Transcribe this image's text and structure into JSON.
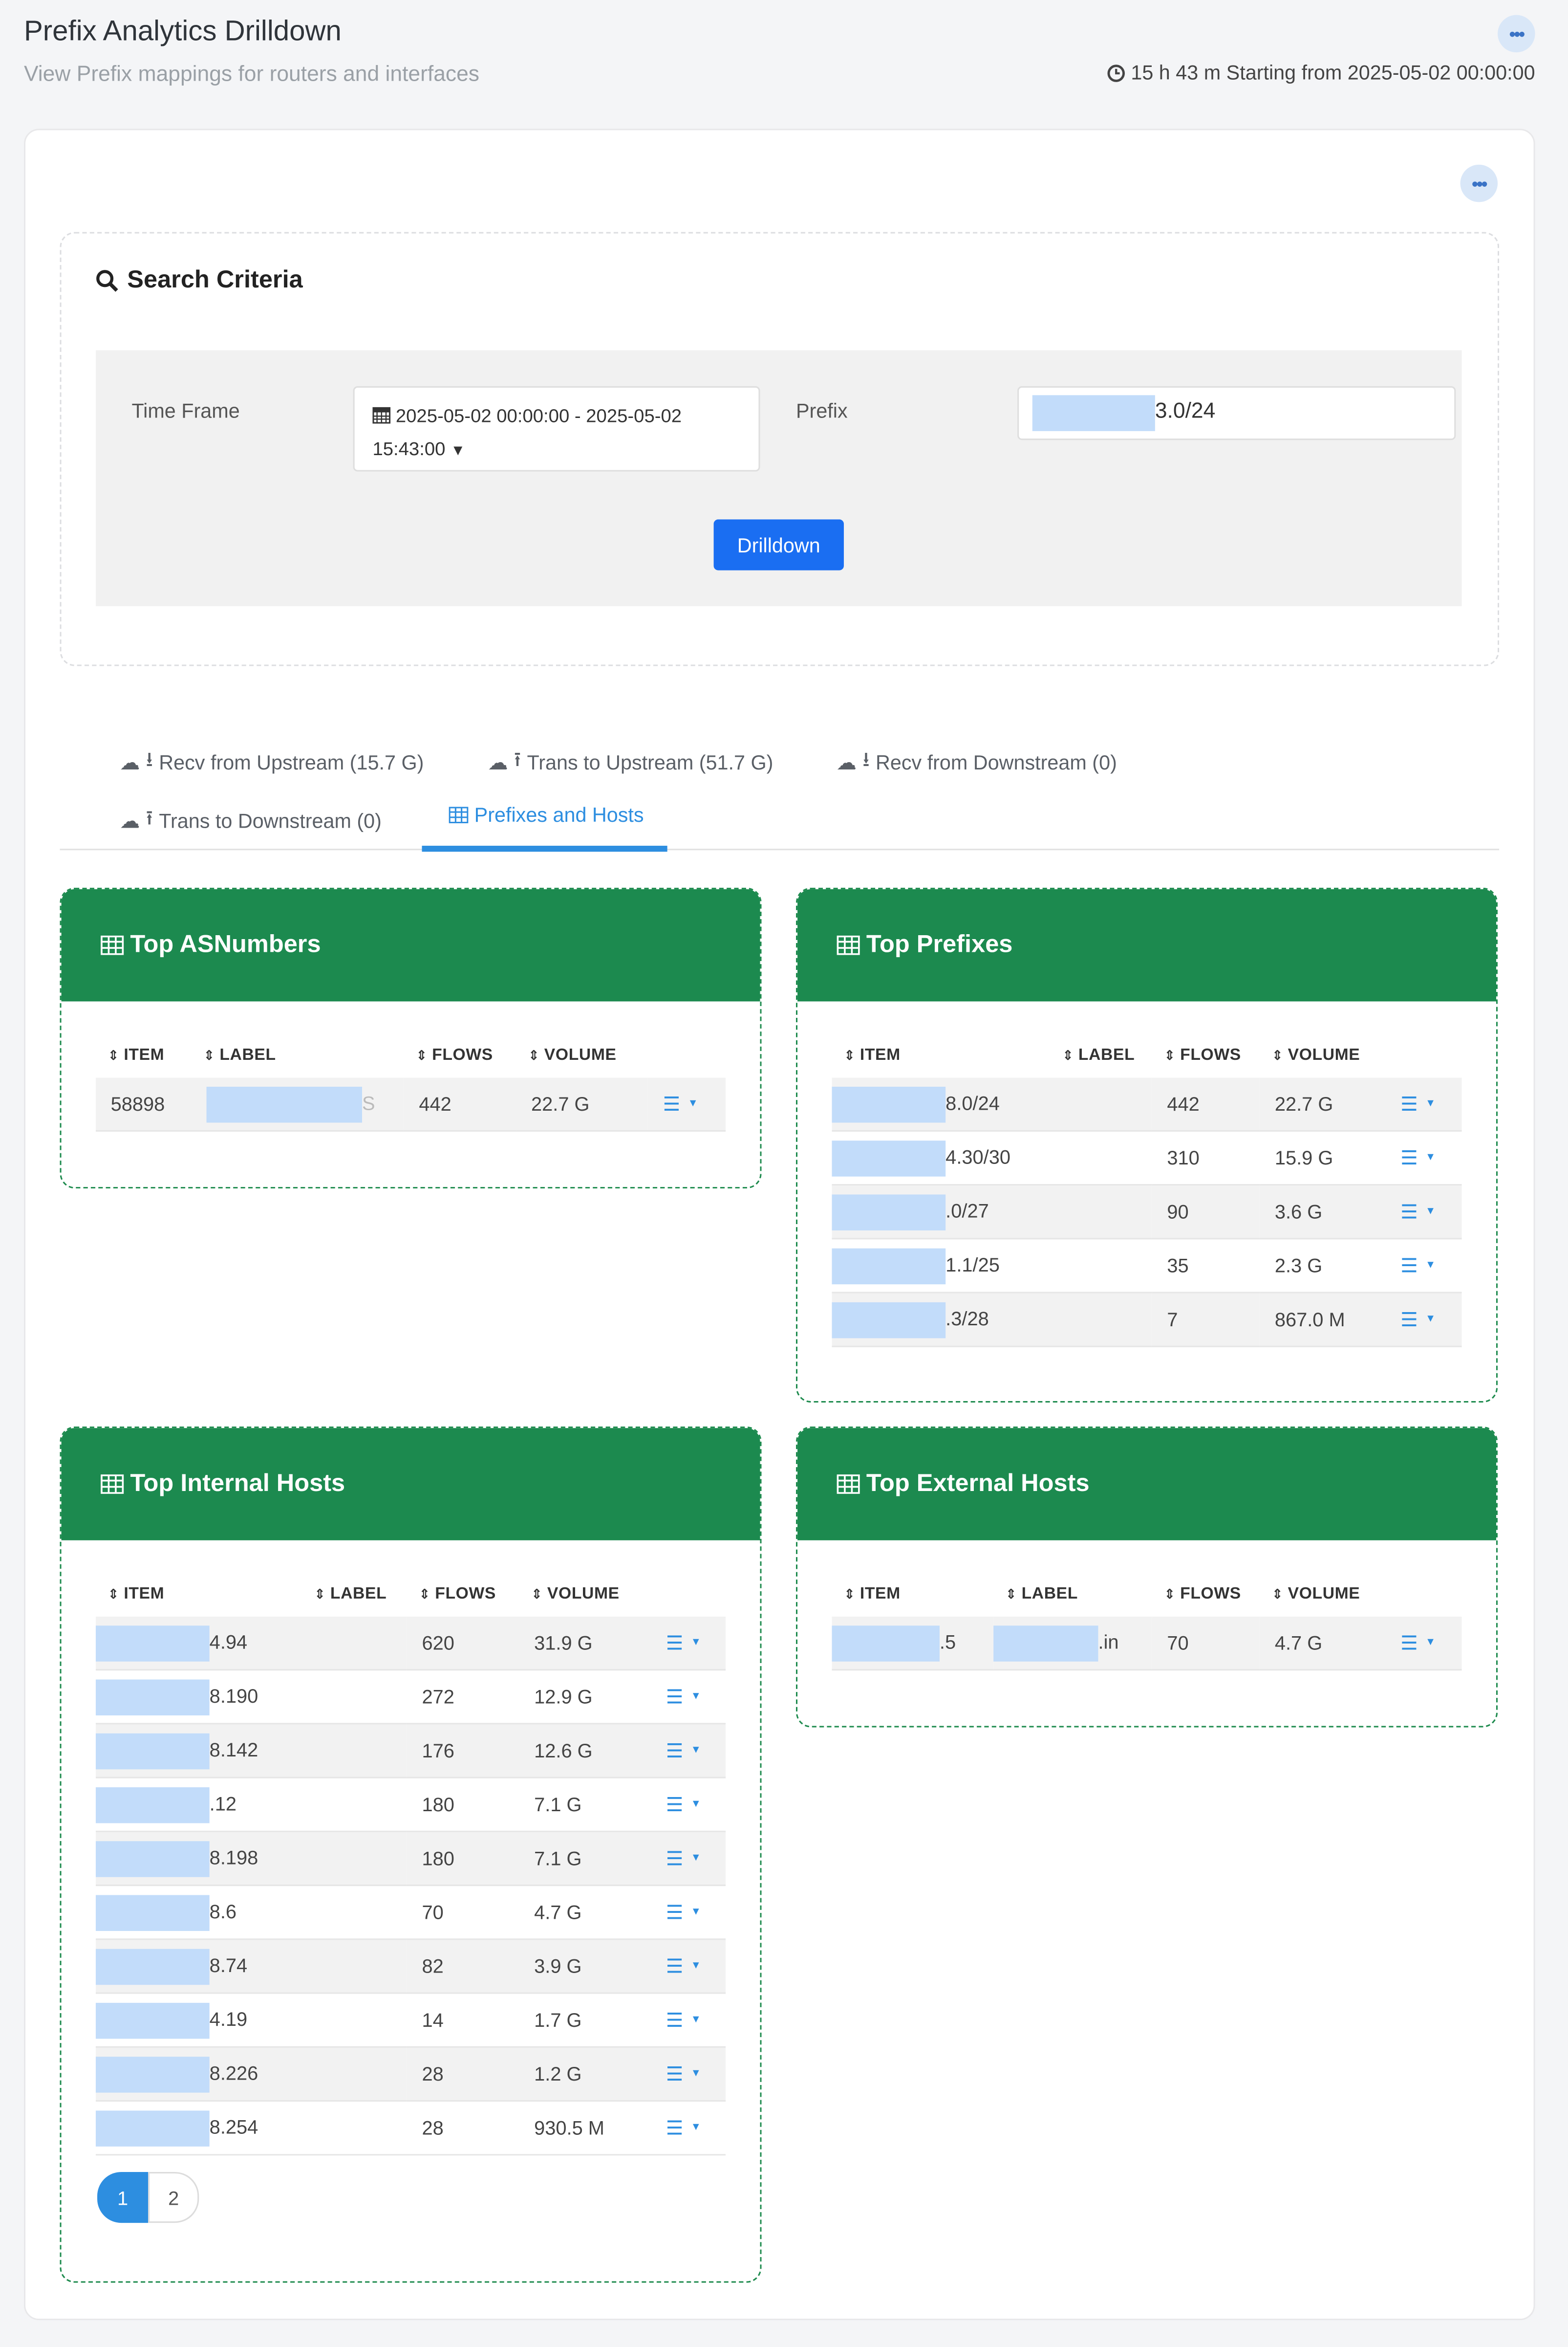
{
  "page": {
    "title": "Prefix Analytics Drilldown",
    "subtitle": "View Prefix mappings for routers and interfaces",
    "time_info": "15 h 43 m Starting from 2025-05-02 00:00:00"
  },
  "search": {
    "title": "Search Criteria",
    "time_frame_label": "Time Frame",
    "time_frame_value": "2025-05-02 00:00:00 - 2025-05-02 15:43:00",
    "prefix_label": "Prefix",
    "prefix_value": "3.0/24",
    "button": "Drilldown"
  },
  "tabs": [
    {
      "label": "Recv from Upstream (15.7 G)"
    },
    {
      "label": "Trans to Upstream (51.7 G)"
    },
    {
      "label": "Recv from Downstream (0)"
    },
    {
      "label": "Trans to Downstream (0)"
    },
    {
      "label": "Prefixes and Hosts"
    }
  ],
  "columns": {
    "item": "ITEM",
    "label": "LABEL",
    "flows": "FLOWS",
    "volume": "VOLUME"
  },
  "asn": {
    "title": "Top ASNumbers",
    "rows": [
      {
        "item": "58898",
        "label": "S",
        "flows": "442",
        "volume": "22.7 G"
      }
    ]
  },
  "prefixes": {
    "title": "Top Prefixes",
    "rows": [
      {
        "item": "8.0/24",
        "flows": "442",
        "volume": "22.7 G"
      },
      {
        "item": "4.30/30",
        "flows": "310",
        "volume": "15.9 G"
      },
      {
        "item": ".0/27",
        "flows": "90",
        "volume": "3.6 G"
      },
      {
        "item": "1.1/25",
        "flows": "35",
        "volume": "2.3 G"
      },
      {
        "item": ".3/28",
        "flows": "7",
        "volume": "867.0 M"
      }
    ]
  },
  "internal": {
    "title": "Top Internal Hosts",
    "rows": [
      {
        "item": "4.94",
        "flows": "620",
        "volume": "31.9 G"
      },
      {
        "item": "8.190",
        "flows": "272",
        "volume": "12.9 G"
      },
      {
        "item": "8.142",
        "flows": "176",
        "volume": "12.6 G"
      },
      {
        "item": ".12",
        "flows": "180",
        "volume": "7.1 G"
      },
      {
        "item": "8.198",
        "flows": "180",
        "volume": "7.1 G"
      },
      {
        "item": "8.6",
        "flows": "70",
        "volume": "4.7 G"
      },
      {
        "item": "8.74",
        "flows": "82",
        "volume": "3.9 G"
      },
      {
        "item": "4.19",
        "flows": "14",
        "volume": "1.7 G"
      },
      {
        "item": "8.226",
        "flows": "28",
        "volume": "1.2 G"
      },
      {
        "item": "8.254",
        "flows": "28",
        "volume": "930.5 M"
      }
    ],
    "pages": [
      "1",
      "2"
    ]
  },
  "external": {
    "title": "Top External Hosts",
    "rows": [
      {
        "item": ".5",
        "label": ".in",
        "flows": "70",
        "volume": "4.7 G"
      }
    ]
  },
  "icons": [
    "ellipsis-icon",
    "clock-icon",
    "search-icon",
    "calendar-icon",
    "caret-down-icon",
    "cloud-icon",
    "upload-icon",
    "download-icon",
    "table-icon",
    "sort-icon",
    "menu-icon"
  ],
  "colors": {
    "accent": "#1a6ef2",
    "panel_header": "#1c8a4f",
    "tab_active": "#2d8ee0"
  }
}
